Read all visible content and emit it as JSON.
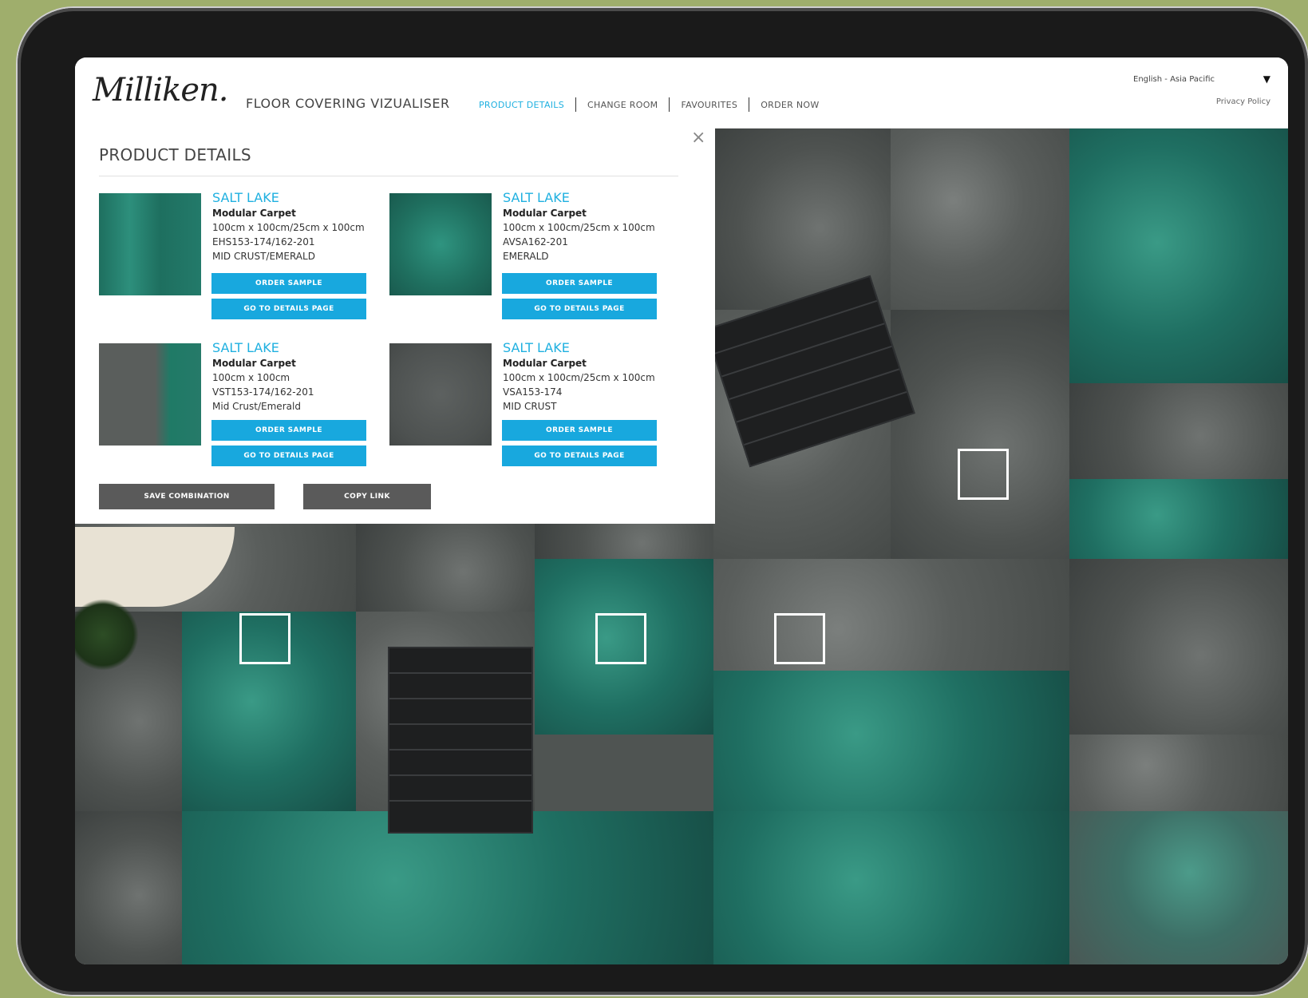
{
  "header": {
    "logo": "Milliken.",
    "app_title": "FLOOR COVERING VIZUALISER",
    "nav": [
      "PRODUCT DETAILS",
      "CHANGE ROOM",
      "FAVOURITES",
      "ORDER NOW"
    ],
    "language": "English - Asia Pacific",
    "privacy": "Privacy Policy"
  },
  "panel": {
    "title": "PRODUCT DETAILS",
    "close": "×",
    "products": [
      {
        "name": "SALT LAKE",
        "type": "Modular Carpet",
        "size": "100cm x 100cm/25cm x 100cm",
        "code": "EHS153-174/162-201",
        "color": "MID CRUST/EMERALD"
      },
      {
        "name": "SALT LAKE",
        "type": "Modular Carpet",
        "size": "100cm x 100cm/25cm x 100cm",
        "code": "AVSA162-201",
        "color": "EMERALD"
      },
      {
        "name": "SALT LAKE",
        "type": "Modular Carpet",
        "size": "100cm x 100cm",
        "code": "VST153-174/162-201",
        "color": "Mid Crust/Emerald"
      },
      {
        "name": "SALT LAKE",
        "type": "Modular Carpet",
        "size": "100cm x 100cm/25cm x 100cm",
        "code": "VSA153-174",
        "color": "MID CRUST"
      }
    ],
    "order_sample_label": "ORDER SAMPLE",
    "details_label": "GO TO DETAILS PAGE",
    "save_label": "SAVE COMBINATION",
    "copy_label": "COPY LINK"
  },
  "colors": {
    "accent": "#18a8de",
    "button_gray": "#5a5a5a",
    "teal_tile": "#1f6f62",
    "gray_tile": "#5a5e5c"
  }
}
